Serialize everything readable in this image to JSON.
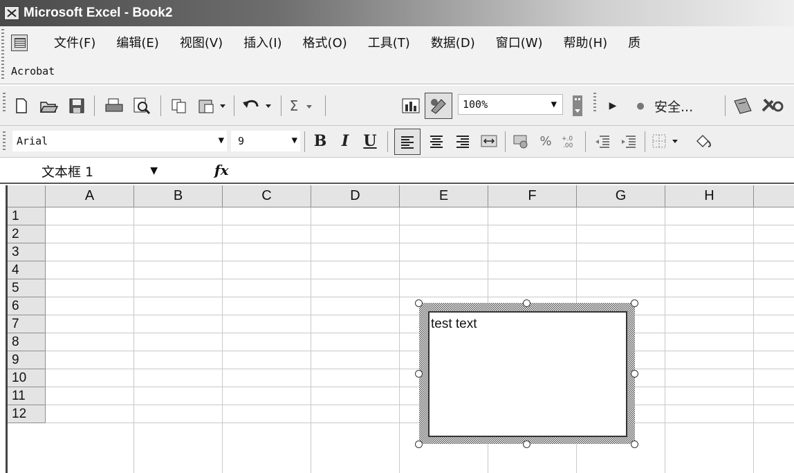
{
  "window": {
    "title": "Microsoft Excel - Book2"
  },
  "menu": {
    "items": [
      "文件(F)",
      "编辑(E)",
      "视图(V)",
      "插入(I)",
      "格式(O)",
      "工具(T)",
      "数据(D)",
      "窗口(W)",
      "帮助(H)",
      "质"
    ],
    "acrobat_label": "Acrobat"
  },
  "toolbar_standard": {
    "sum_symbol": "Σ",
    "zoom_value": "100%",
    "security_label": "安全..."
  },
  "toolbar_formatting": {
    "font_name": "Arial",
    "font_size": "9",
    "bold_label": "B",
    "italic_label": "I",
    "underline_label": "U",
    "percent_label": "%"
  },
  "formula_bar": {
    "name_box_value": "文本框 1",
    "fx_label": "fx"
  },
  "sheet": {
    "columns": [
      "A",
      "B",
      "C",
      "D",
      "E",
      "F",
      "G",
      "H"
    ],
    "rows": [
      "1",
      "2",
      "3",
      "4",
      "5",
      "6",
      "7",
      "8",
      "9",
      "10",
      "11",
      "12"
    ]
  },
  "textbox": {
    "text": "test text"
  }
}
